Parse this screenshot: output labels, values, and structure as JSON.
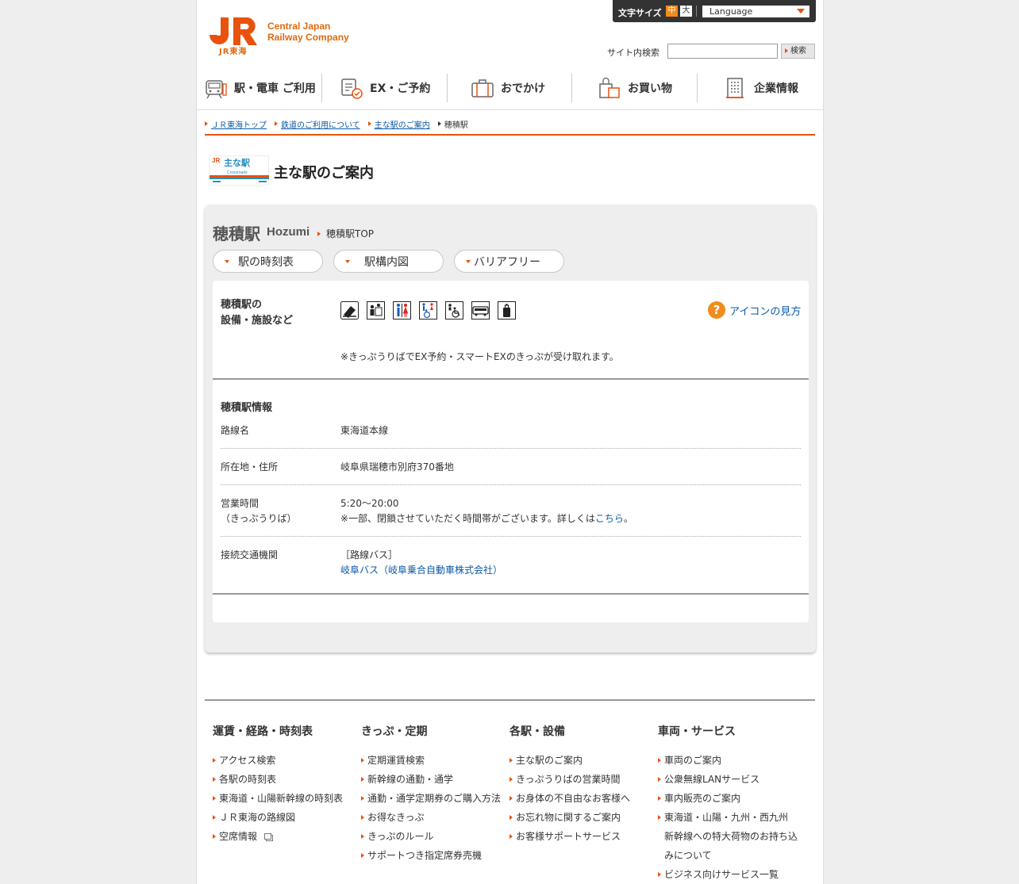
{
  "header": {
    "logo_sub": "JR東海",
    "logo_text": "Central Japan\nRailway Company",
    "textsize_label": "文字サイズ",
    "textsize_mid": "中",
    "textsize_large": "大",
    "language_selected": "Language",
    "search_label": "サイト内検索",
    "search_value": "",
    "search_button": "検索"
  },
  "gnav": [
    {
      "label": "駅・電車 ご利用",
      "icon": "train-icon"
    },
    {
      "label": "EX・ご予約",
      "icon": "reservation-icon"
    },
    {
      "label": "おでかけ",
      "icon": "luggage-icon"
    },
    {
      "label": "お買い物",
      "icon": "shopping-bag-icon"
    },
    {
      "label": "企業情報",
      "icon": "building-icon"
    }
  ],
  "breadcrumb": [
    "ＪＲ東海トップ",
    "鉄道のご利用について",
    "主な駅のご案内",
    "穂積駅"
  ],
  "page_title": "主な駅のご案内",
  "badge": {
    "title": "主な駅",
    "sub": "Crossroads"
  },
  "station": {
    "name": "穂積駅",
    "name_en": "Hozumi",
    "top_link": "穂積駅TOP",
    "tabs": [
      "駅の時刻表",
      "駅構内図",
      "バリアフリー"
    ],
    "facilities_label": "穂積駅の\n設備・施設など",
    "facility_icons": [
      "ticket-office-icon",
      "ticket-counter-icon",
      "toilet-icon",
      "multipurpose-toilet-icon",
      "wheelchair-icon",
      "bus-icon",
      "coin-locker-icon"
    ],
    "help_label": "アイコンの見方",
    "facilities_note": "※きっぷうりばでEX予約・スマートEXのきっぷが受け取れます。",
    "info_heading": "穂積駅情報",
    "info": {
      "line_key": "路線名",
      "line_val": "東海道本線",
      "address_key": "所在地・住所",
      "address_val": "岐阜県瑞穂市別府370番地",
      "hours_key": "営業時間\n（きっぷうりば）",
      "hours_val": "5:20〜20:00",
      "hours_note": "※一部、閉鎖させていただく時間帯がございます。詳しくは",
      "hours_link": "こちら",
      "hours_tail": "。",
      "transit_key": "接続交通機関",
      "transit_type": "［路線バス］",
      "transit_link": "岐阜バス（岐阜乗合自動車株式会社）"
    }
  },
  "footer": [
    {
      "title": "運賃・経路・時刻表",
      "items": [
        "アクセス検索",
        "各駅の時刻表",
        "東海道・山陽新幹線の時刻表",
        "ＪＲ東海の路線図",
        "空席情報"
      ]
    },
    {
      "title": "きっぷ・定期",
      "items": [
        "定期運賃検索",
        "新幹線の通勤・通学",
        "通勤・通学定期券のご購入方法",
        "お得なきっぷ",
        "きっぷのルール",
        "サポートつき指定席券売機"
      ]
    },
    {
      "title": "各駅・設備",
      "items": [
        "主な駅のご案内",
        "きっぷうりばの営業時間",
        "お身体の不自由なお客様へ",
        "お忘れ物に関するご案内",
        "お客様サポートサービス"
      ]
    },
    {
      "title": "車両・サービス",
      "items": [
        "車両のご案内",
        "公衆無線LANサービス",
        "車内販売のご案内",
        "東海道・山陽・九州・西九州",
        "新幹線への特大荷物のお持ち込",
        "みについて",
        "ビジネス向けサービス一覧"
      ]
    }
  ],
  "colors": {
    "brand_orange": "#e8520c",
    "link_blue": "#0b5aa8"
  }
}
